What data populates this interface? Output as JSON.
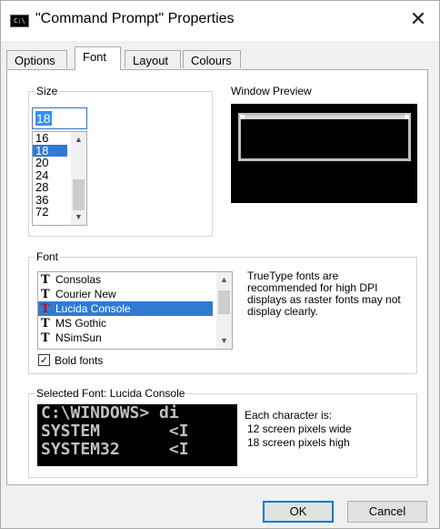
{
  "window": {
    "icon_text": "C:\\",
    "title": "\"Command Prompt\" Properties",
    "close_glyph": "✕"
  },
  "tabs": [
    {
      "label": "Options",
      "active": false
    },
    {
      "label": "Font",
      "active": true
    },
    {
      "label": "Layout",
      "active": false
    },
    {
      "label": "Colours",
      "active": false
    }
  ],
  "size": {
    "group_label": "Size",
    "current_value": "18",
    "options": [
      "16",
      "18",
      "20",
      "24",
      "28",
      "36",
      "72"
    ],
    "selected": "18"
  },
  "preview": {
    "label": "Window Preview"
  },
  "font": {
    "group_label": "Font",
    "options": [
      "Consolas",
      "Courier New",
      "Lucida Console",
      "MS Gothic",
      "NSimSun"
    ],
    "selected": "Lucida Console",
    "truetype_icon": "truetype-icon",
    "note": "TrueType fonts are recommended for high DPI displays as raster fonts may not display clearly.",
    "bold_label": "Bold fonts",
    "bold_checked": true,
    "check_glyph": "✓"
  },
  "selected_font": {
    "group_label": "Selected Font: Lucida Console",
    "sample_lines": [
      "C:\\WINDOWS> di",
      "SYSTEM       <I",
      "SYSTEM32     <I"
    ],
    "info_heading": "Each character is:",
    "info_width": "12 screen pixels wide",
    "info_height": "18 screen pixels high"
  },
  "buttons": {
    "ok": "OK",
    "cancel": "Cancel"
  },
  "colors": {
    "selection": "#2f7bd2",
    "focus_border": "#2e73c9",
    "console_bg": "#000000",
    "console_text": "#c0c0c0"
  }
}
